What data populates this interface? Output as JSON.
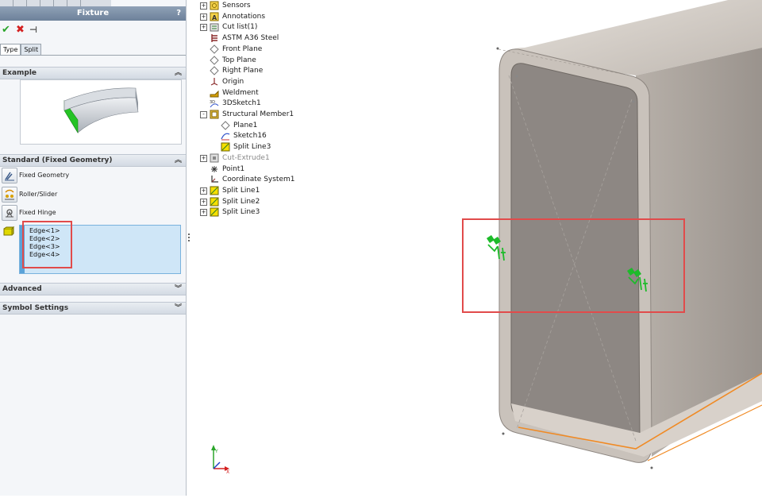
{
  "panel": {
    "title": "Fixture",
    "help": "?",
    "ok_icon": "✔",
    "cancel_icon": "✖",
    "pin_icon": "⊣",
    "tabs": [
      "Type",
      "Split"
    ],
    "sections": {
      "example": "Example",
      "standard": "Standard (Fixed Geometry)",
      "advanced": "Advanced",
      "symbol": "Symbol Settings"
    },
    "options": [
      "Fixed Geometry",
      "Roller/Slider",
      "Fixed Hinge"
    ],
    "selected_edges": [
      "Edge<1>",
      "Edge<2>",
      "Edge<3>",
      "Edge<4>"
    ]
  },
  "tree": [
    {
      "label": "Sensors",
      "icon": "sensor-icon",
      "expander": "+"
    },
    {
      "label": "Annotations",
      "icon": "annotation-icon",
      "expander": "+"
    },
    {
      "label": "Cut list(1)",
      "icon": "cutlist-icon",
      "expander": "+"
    },
    {
      "label": "ASTM A36 Steel",
      "icon": "material-icon",
      "expander": ""
    },
    {
      "label": "Front Plane",
      "icon": "plane-icon",
      "expander": ""
    },
    {
      "label": "Top Plane",
      "icon": "plane-icon",
      "expander": ""
    },
    {
      "label": "Right Plane",
      "icon": "plane-icon",
      "expander": ""
    },
    {
      "label": "Origin",
      "icon": "origin-icon",
      "expander": ""
    },
    {
      "label": "Weldment",
      "icon": "weldment-icon",
      "expander": ""
    },
    {
      "label": "3DSketch1",
      "icon": "sketch3d-icon",
      "expander": ""
    },
    {
      "label": "Structural Member1",
      "icon": "structural-member-icon",
      "expander": "−"
    },
    {
      "label": "Plane1",
      "icon": "plane-icon",
      "expander": "",
      "indent": 1
    },
    {
      "label": "Sketch16",
      "icon": "sketch-icon",
      "expander": "",
      "indent": 1
    },
    {
      "label": "Split Line3",
      "icon": "splitline-icon",
      "expander": "",
      "indent": 1
    },
    {
      "label": "Cut-Extrude1",
      "icon": "cut-extrude-icon",
      "expander": "+",
      "grey": true
    },
    {
      "label": "Point1",
      "icon": "point-icon",
      "expander": ""
    },
    {
      "label": "Coordinate System1",
      "icon": "coordinate-system-icon",
      "expander": ""
    },
    {
      "label": "Split Line1",
      "icon": "splitline-icon",
      "expander": "+"
    },
    {
      "label": "Split Line2",
      "icon": "splitline-icon",
      "expander": "+"
    },
    {
      "label": "Split Line3",
      "icon": "splitline-icon",
      "expander": "+"
    }
  ],
  "colors": {
    "highlight_box": "#e14b4b",
    "fixture_symbol": "#1dbb2a",
    "edge_highlight": "#f08a24",
    "part_face": "#8d8783",
    "part_rim": "#c7c0b9"
  }
}
